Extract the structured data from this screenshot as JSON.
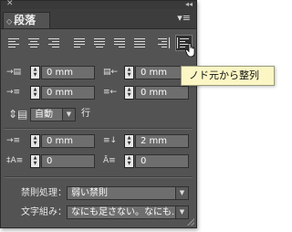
{
  "panel": {
    "close_glyph": "✕",
    "collapse_glyph": "◂◂",
    "tab_label": "段落",
    "tab_glyph": "◇",
    "menu_glyph": "▾≡"
  },
  "alignment": {
    "selected": "justify-away-from-spine"
  },
  "indent": {
    "left": "0 mm",
    "right": "0 mm",
    "first_line": "0 mm",
    "last_line": "0 mm"
  },
  "leading": {
    "value": "自動",
    "unit": "行"
  },
  "spacing": {
    "before": "0 mm",
    "after": "2 mm",
    "drop_cap_lines": "0",
    "drop_cap_chars": "0"
  },
  "kinsoku": {
    "label": "禁則処理：",
    "value": "弱い禁則"
  },
  "mojikumi": {
    "label": "文字組み：",
    "value": "なにも足さない。なにも..."
  },
  "tooltip": {
    "text": "ノド元から整列"
  }
}
